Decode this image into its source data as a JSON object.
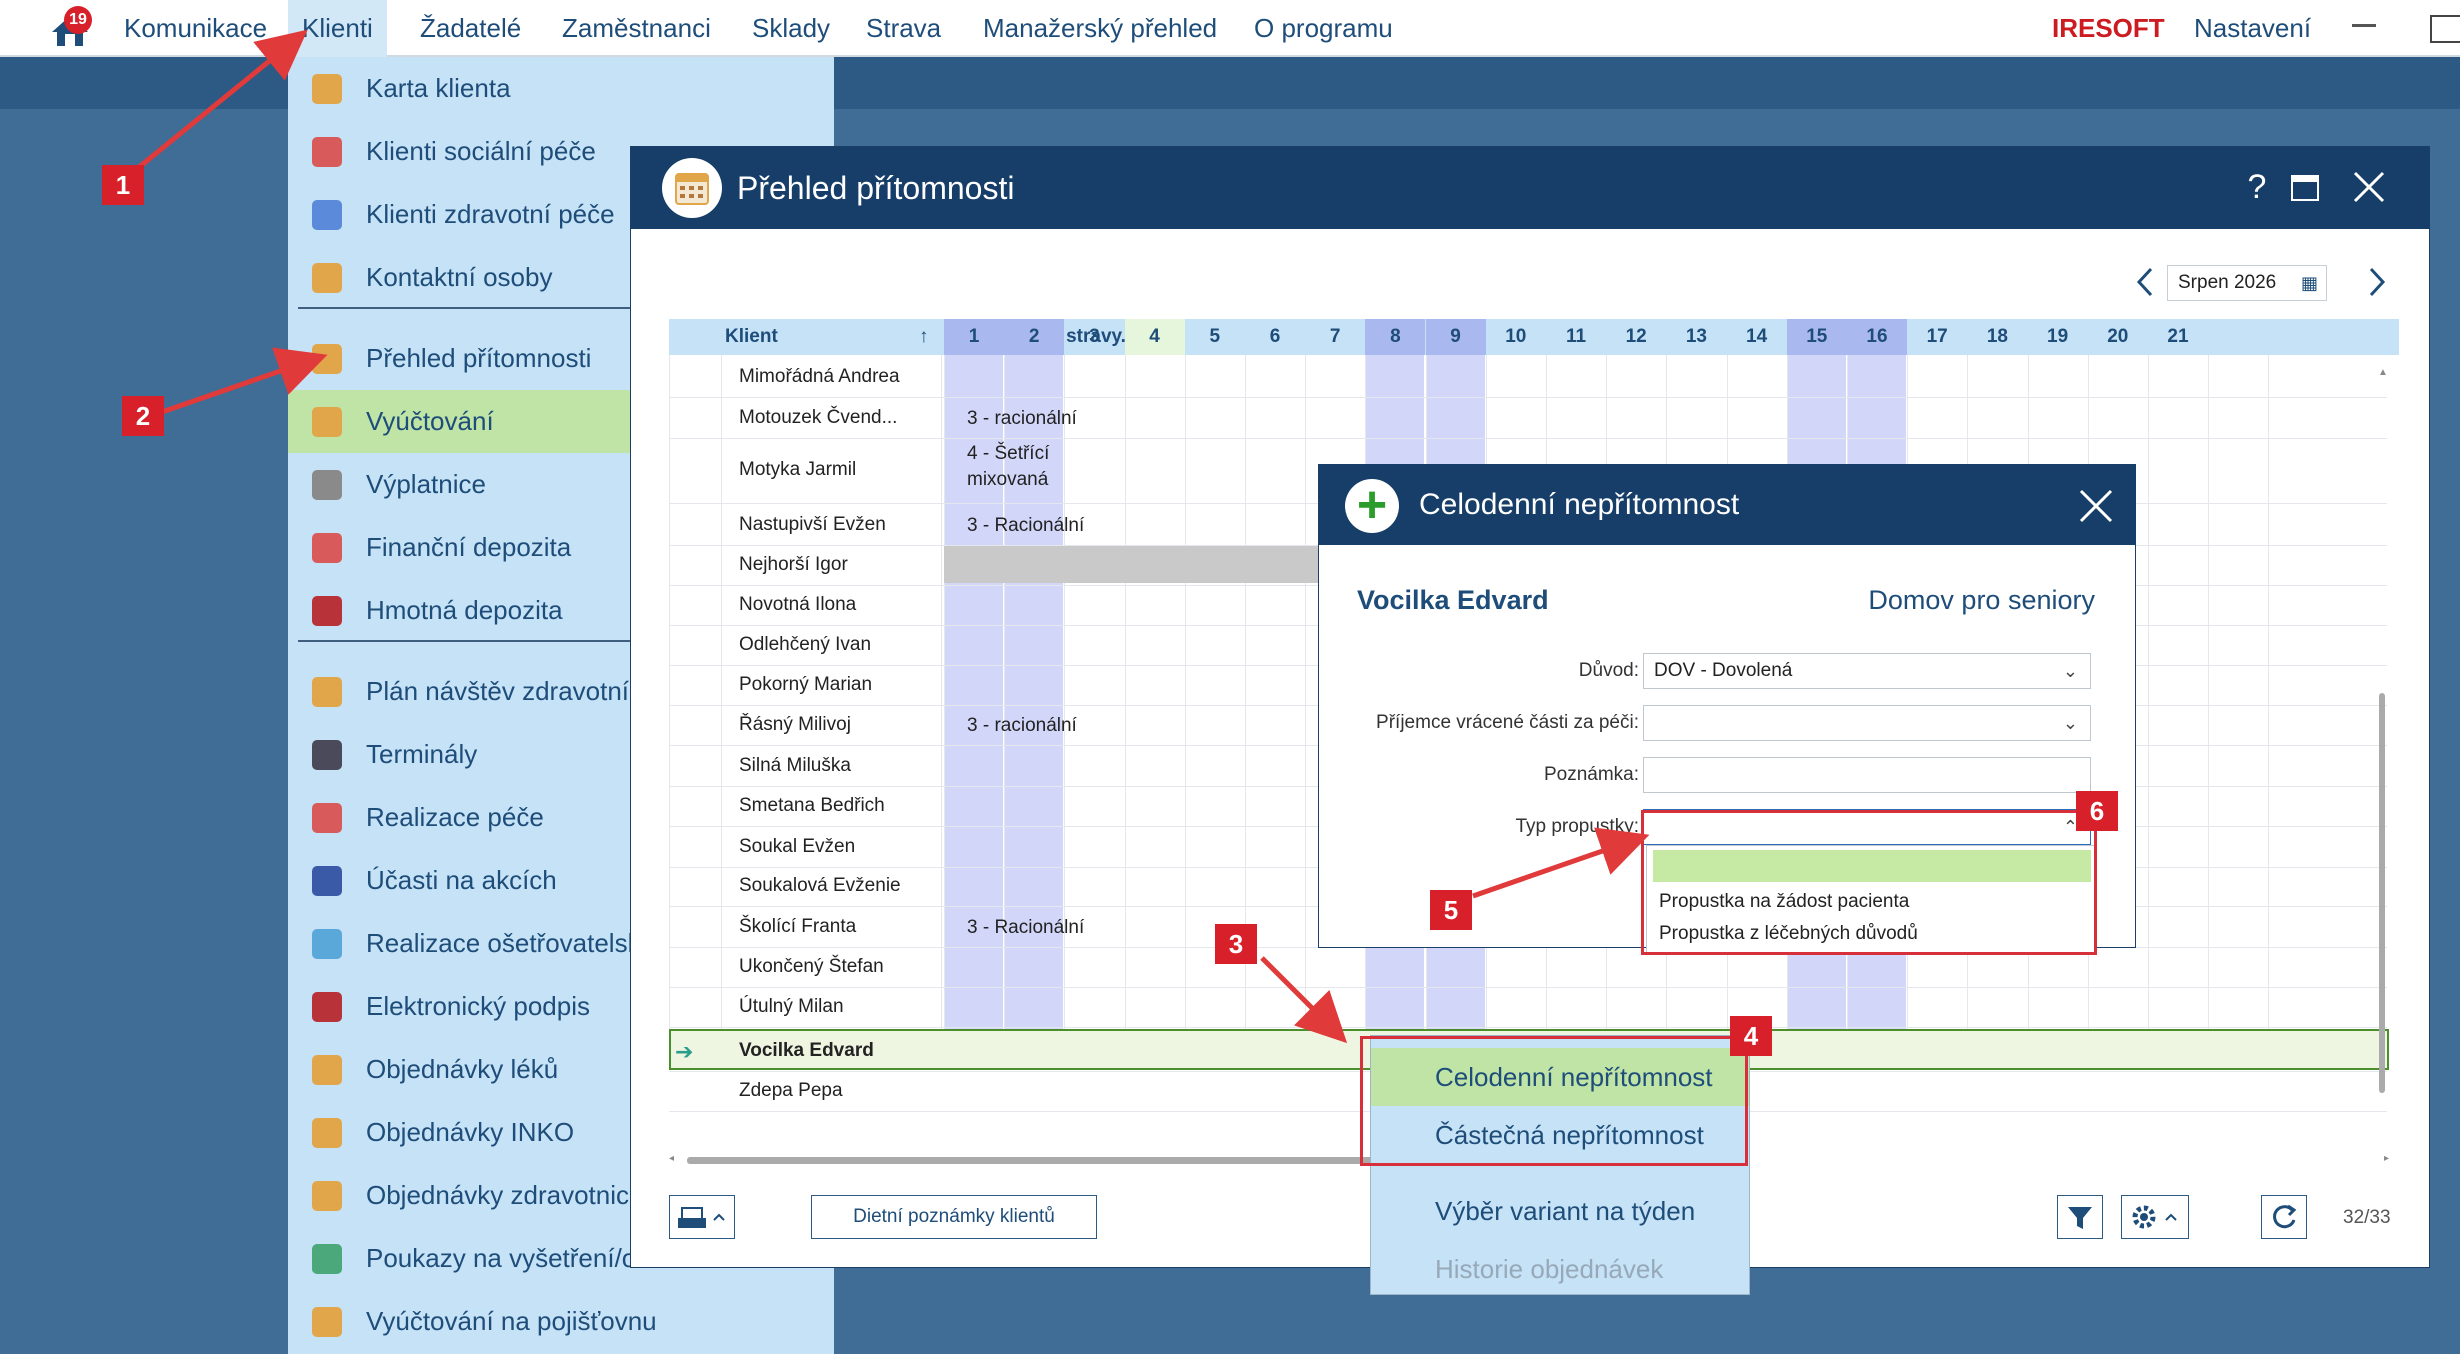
{
  "topbar": {
    "notification_count": "19",
    "nav": [
      "Komunikace",
      "Klienti",
      "Žadatelé",
      "Zaměstnanci",
      "Sklady",
      "Strava",
      "Manažerský přehled",
      "O programu"
    ],
    "active_nav": "Klienti",
    "brand": "IRESOFT",
    "settings": "Nastavení"
  },
  "menu": {
    "items": [
      {
        "label": "Karta klienta",
        "icon": "id-card-icon",
        "color": "#e2a64a"
      },
      {
        "label": "Klienti sociální péče",
        "icon": "people-icon",
        "color": "#d95a5a"
      },
      {
        "label": "Klienti zdravotní péče",
        "icon": "people-care-icon",
        "color": "#5a8ad9"
      },
      {
        "label": "Kontaktní osoby",
        "icon": "phone-book-icon",
        "color": "#e2a64a"
      },
      {
        "label": "Přehled přítomnosti",
        "icon": "calendar-icon",
        "color": "#e2a64a"
      },
      {
        "label": "Vyúčtování",
        "icon": "invoice-icon",
        "color": "#e2a64a"
      },
      {
        "label": "Výplatnice",
        "icon": "payslip-icon",
        "color": "#8a8a8a"
      },
      {
        "label": "Finanční depozita",
        "icon": "piggy-bank-icon",
        "color": "#d95a5a"
      },
      {
        "label": "Hmotná depozita",
        "icon": "briefcase-icon",
        "color": "#b8323a"
      },
      {
        "label": "Plán návštěv zdravotní",
        "icon": "visit-plan-icon",
        "color": "#e2a64a"
      },
      {
        "label": "Terminály",
        "icon": "terminal-icon",
        "color": "#4a4a5a"
      },
      {
        "label": "Realizace péče",
        "icon": "care-icon",
        "color": "#d95a5a"
      },
      {
        "label": "Účasti na akcích",
        "icon": "mask-icon",
        "color": "#3a5aa8"
      },
      {
        "label": "Realizace ošetřovatelsk",
        "icon": "nurse-icon",
        "color": "#5aa8d9"
      },
      {
        "label": "Elektronický podpis",
        "icon": "signature-icon",
        "color": "#b8323a"
      },
      {
        "label": "Objednávky léků",
        "icon": "medicine-icon",
        "color": "#e2a64a"
      },
      {
        "label": "Objednávky INKO",
        "icon": "drop-icon",
        "color": "#e2a64a"
      },
      {
        "label": "Objednávky zdravotnick",
        "icon": "medical-supply-icon",
        "color": "#e2a64a"
      },
      {
        "label": "Poukazy na vyšetření/o",
        "icon": "voucher-icon",
        "color": "#4aa87a"
      },
      {
        "label": "Vyúčtování na pojišťovnu",
        "icon": "insurance-icon",
        "color": "#e2a64a"
      }
    ],
    "selected": "Vyúčtování"
  },
  "window": {
    "title": "Přehled přítomnosti",
    "help": "?",
    "month": "Srpen 2026",
    "col_client": "Klient",
    "col_diet": "Dieta, forma stravy...",
    "days": [
      "1",
      "2",
      "3",
      "4",
      "5",
      "6",
      "7",
      "8",
      "9",
      "10",
      "11",
      "12",
      "13",
      "14",
      "15",
      "16",
      "17",
      "18",
      "19",
      "20",
      "21"
    ],
    "weekend_days": [
      "1",
      "2",
      "8",
      "9",
      "15",
      "16"
    ],
    "rows": [
      {
        "name": "Mimořádná Andrea",
        "diet": ""
      },
      {
        "name": "Motouzek Čvend...",
        "diet": "3 - racionální"
      },
      {
        "name": "Motyka Jarmil",
        "diet": "4 - Šetřící\nmixovaná"
      },
      {
        "name": "Nastupivší Evžen",
        "diet": "3 - Racionální"
      },
      {
        "name": "Nejhorší Igor",
        "diet": ""
      },
      {
        "name": "Novotná Ilona",
        "diet": ""
      },
      {
        "name": "Odlehčený Ivan",
        "diet": ""
      },
      {
        "name": "Pokorný Marian",
        "diet": ""
      },
      {
        "name": "Řásný Milivoj",
        "diet": "3 - racionální"
      },
      {
        "name": "Silná Miluška",
        "diet": ""
      },
      {
        "name": "Smetana Bedřich",
        "diet": ""
      },
      {
        "name": "Soukal Evžen",
        "diet": ""
      },
      {
        "name": "Soukalová Evženie",
        "diet": ""
      },
      {
        "name": "Školící Franta",
        "diet": "3 - Racionální"
      },
      {
        "name": "Ukončený Štefan",
        "diet": ""
      },
      {
        "name": "Útulný Milan",
        "diet": ""
      },
      {
        "name": "Vocilka Edvard",
        "diet": ""
      },
      {
        "name": "Zdepa Pepa",
        "diet": ""
      }
    ],
    "selected_row": "Vocilka Edvard",
    "diet_notes_button": "Dietní poznámky klientů",
    "record_count": "32/33"
  },
  "dialog": {
    "title": "Celodenní nepřítomnost",
    "client": "Vocilka Edvard",
    "facility": "Domov pro seniory",
    "reason_label": "Důvod:",
    "reason_value": "DOV - Dovolená",
    "recipient_label": "Příjemce vrácené části za péči:",
    "recipient_value": "",
    "note_label": "Poznámka:",
    "note_value": "",
    "pass_type_label": "Typ propustky:",
    "pass_type_value": "",
    "pass_options": [
      "",
      "Propustka na žádost pacienta",
      "Propustka z léčebných důvodů"
    ]
  },
  "context_menu": {
    "items": [
      "Celodenní nepřítomnost",
      "Částečná nepřítomnost",
      "Výběr variant na týden",
      "Historie objednávek"
    ]
  },
  "callouts": [
    "1",
    "2",
    "3",
    "4",
    "5",
    "6"
  ]
}
